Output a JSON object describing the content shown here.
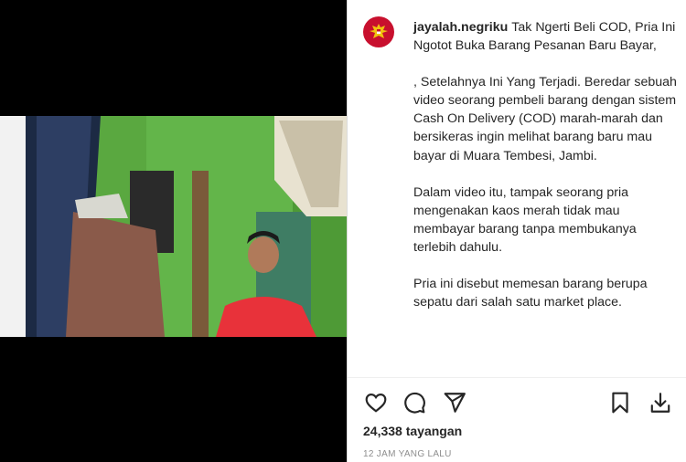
{
  "post": {
    "username": "jayalah.negriku",
    "headline": "Tak Ngerti Beli COD, Pria Ini Ngotot Buka Barang Pesanan Baru Bayar,",
    "paragraphs": [
      ", Setelahnya Ini Yang Terjadi. Beredar sebuah video seorang pembeli barang dengan sistem Cash On Delivery (COD) marah-marah dan bersikeras ingin melihat barang baru mau bayar di Muara Tembesi, Jambi.",
      "Dalam video itu, tampak seorang pria mengenakan kaos merah tidak mau membayar barang tanpa membukanya terlebih dahulu.",
      "Pria ini disebut memesan barang berupa sepatu dari salah satu market place."
    ],
    "views": "24,338 tayangan",
    "timestamp": "12 JAM YANG LALU"
  },
  "icons": {
    "avatar": "garuda-emblem-icon",
    "like": "heart-icon",
    "comment": "comment-icon",
    "share": "paper-plane-icon",
    "save": "bookmark-icon",
    "download": "download-icon"
  },
  "colors": {
    "avatar_bg": "#c8102e",
    "text": "#262626",
    "muted": "#8e8e8e",
    "video_wall": "#5fae43",
    "shirt": "#e8323a"
  }
}
